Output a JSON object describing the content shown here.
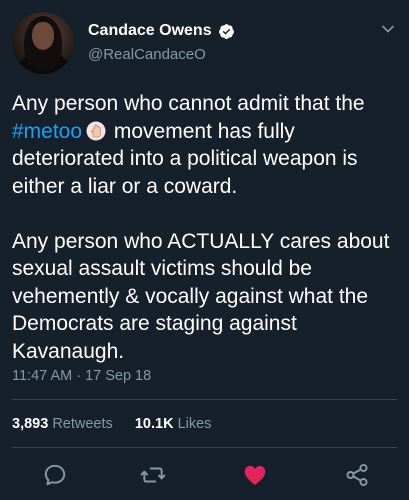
{
  "user": {
    "display_name": "Candace Owens",
    "handle": "@RealCandaceO",
    "verified": true
  },
  "icons": {
    "verified": "verified-badge-icon",
    "menu": "chevron-down-icon",
    "reply": "reply-icon",
    "retweet": "retweet-icon",
    "like": "heart-icon",
    "share": "share-icon",
    "emoji": "raised-hand-emoji"
  },
  "tweet": {
    "p1_before": "Any person who cannot admit that the ",
    "hashtag": "#metoo",
    "p1_after": " movement has fully deteriorated into a political weapon is either a liar or a coward.",
    "p2": "Any person who ACTUALLY cares about sexual assault victims should be vehemently & vocally against what the Democrats are staging against Kavanaugh.",
    "timestamp": "11:47 AM · 17 Sep 18"
  },
  "stats": {
    "retweets_count": "3,893",
    "retweets_label": "Retweets",
    "likes_count": "10.1K",
    "likes_label": "Likes"
  },
  "colors": {
    "background": "#15202b",
    "text": "#ffffff",
    "secondary": "#8899a6",
    "link": "#1da1f2",
    "like_active": "#e0245e",
    "divider": "#38444d"
  }
}
